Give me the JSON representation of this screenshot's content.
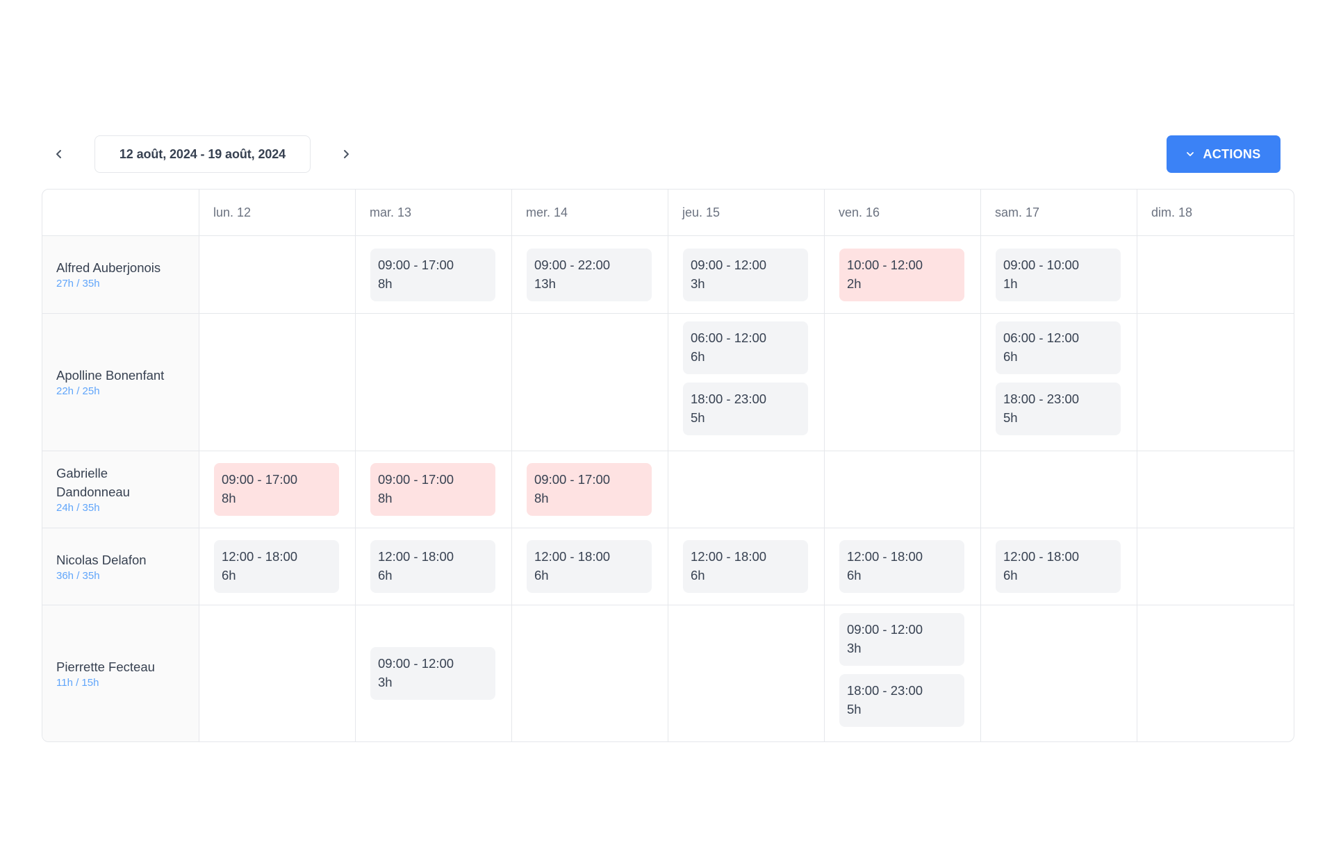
{
  "toolbar": {
    "prev_icon": "chevron-left-icon",
    "date_range": "12 août, 2024 - 19 août, 2024",
    "next_icon": "chevron-right-icon",
    "actions_label": "ACTIONS",
    "actions_icon": "chevron-down-icon",
    "accent_color": "#3b82f6"
  },
  "days": [
    "lun. 12",
    "mar. 13",
    "mer. 14",
    "jeu. 15",
    "ven. 16",
    "sam. 17",
    "dim. 18"
  ],
  "shift_colors": {
    "normal": "#f3f4f6",
    "alert": "#fee2e2"
  },
  "employees": [
    {
      "name": "Alfred Auberjonois",
      "hours": "27h / 35h",
      "shifts": [
        [],
        [
          {
            "time": "09:00 - 17:00",
            "duration": "8h",
            "alert": false
          }
        ],
        [
          {
            "time": "09:00 - 22:00",
            "duration": "13h",
            "alert": false
          }
        ],
        [
          {
            "time": "09:00 - 12:00",
            "duration": "3h",
            "alert": false
          }
        ],
        [
          {
            "time": "10:00 - 12:00",
            "duration": "2h",
            "alert": true
          }
        ],
        [
          {
            "time": "09:00 - 10:00",
            "duration": "1h",
            "alert": false
          }
        ],
        []
      ]
    },
    {
      "name": "Apolline Bonenfant",
      "hours": "22h / 25h",
      "shifts": [
        [],
        [],
        [],
        [
          {
            "time": "06:00 - 12:00",
            "duration": "6h",
            "alert": false
          },
          {
            "time": "18:00 - 23:00",
            "duration": "5h",
            "alert": false
          }
        ],
        [],
        [
          {
            "time": "06:00 - 12:00",
            "duration": "6h",
            "alert": false
          },
          {
            "time": "18:00 - 23:00",
            "duration": "5h",
            "alert": false
          }
        ],
        []
      ]
    },
    {
      "name": "Gabrielle Dandonneau",
      "hours": "24h / 35h",
      "shifts": [
        [
          {
            "time": "09:00 - 17:00",
            "duration": "8h",
            "alert": true
          }
        ],
        [
          {
            "time": "09:00 - 17:00",
            "duration": "8h",
            "alert": true
          }
        ],
        [
          {
            "time": "09:00 - 17:00",
            "duration": "8h",
            "alert": true
          }
        ],
        [],
        [],
        [],
        []
      ]
    },
    {
      "name": "Nicolas Delafon",
      "hours": "36h / 35h",
      "shifts": [
        [
          {
            "time": "12:00 - 18:00",
            "duration": "6h",
            "alert": false
          }
        ],
        [
          {
            "time": "12:00 - 18:00",
            "duration": "6h",
            "alert": false
          }
        ],
        [
          {
            "time": "12:00 - 18:00",
            "duration": "6h",
            "alert": false
          }
        ],
        [
          {
            "time": "12:00 - 18:00",
            "duration": "6h",
            "alert": false
          }
        ],
        [
          {
            "time": "12:00 - 18:00",
            "duration": "6h",
            "alert": false
          }
        ],
        [
          {
            "time": "12:00 - 18:00",
            "duration": "6h",
            "alert": false
          }
        ],
        []
      ]
    },
    {
      "name": "Pierrette Fecteau",
      "hours": "11h / 15h",
      "shifts": [
        [],
        [
          {
            "time": "09:00 - 12:00",
            "duration": "3h",
            "alert": false
          }
        ],
        [],
        [],
        [
          {
            "time": "09:00 - 12:00",
            "duration": "3h",
            "alert": false
          },
          {
            "time": "18:00 - 23:00",
            "duration": "5h",
            "alert": false
          }
        ],
        [],
        []
      ]
    }
  ]
}
